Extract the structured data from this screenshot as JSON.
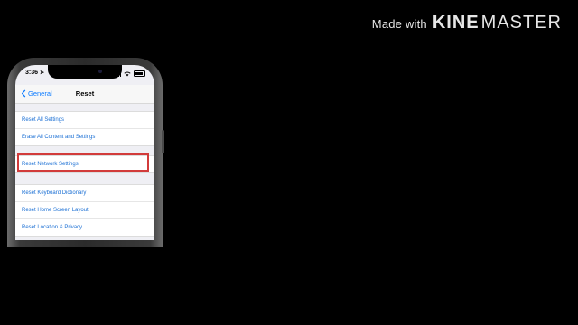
{
  "watermark": {
    "made_with": "Made with",
    "kine": "KINE",
    "master": "MASTER"
  },
  "status_bar": {
    "time": "3:36",
    "location_arrow": "➤"
  },
  "nav": {
    "back_label": "General",
    "title": "Reset"
  },
  "groups": [
    {
      "items": [
        "Reset All Settings",
        "Erase All Content and Settings"
      ]
    },
    {
      "items": [
        "Reset Network Settings"
      ],
      "highlighted": true,
      "highlight_color": "#d23b3b"
    },
    {
      "items": [
        "Reset Keyboard Dictionary",
        "Reset Home Screen Layout",
        "Reset Location & Privacy"
      ]
    }
  ],
  "colors": {
    "link": "#1a6fd4",
    "accent": "#0a7aff",
    "background": "#efeff4"
  }
}
